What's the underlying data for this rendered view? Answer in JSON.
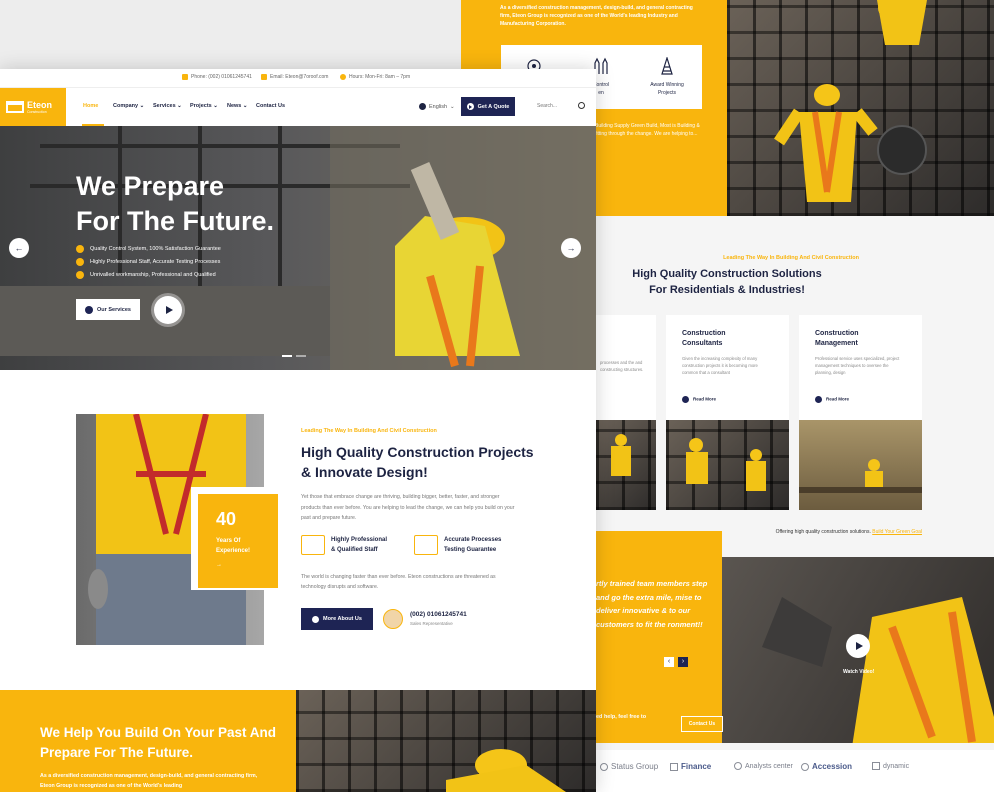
{
  "back_panel": {
    "intro_text": "As a diversified construction management, design-build, and general contracting firm, Eteon Group is recognized as one of the World's leading Industry and Manufacturing Corporation.",
    "feature_cards": [
      {
        "label": "",
        "icon": "gears-icon"
      },
      {
        "label": "Control\nen",
        "icon": "gloves-icon"
      },
      {
        "label": "Award Winning\nProjects",
        "icon": "tower-icon"
      }
    ],
    "yellow_small_text": "Building Supply Green Build, Most is Building & fitting through the change. We are helping to...",
    "eyebrow": "Leading The Way In Building And Civil Construction",
    "title_line1": "High Quality Construction Solutions",
    "title_line2": "For Residentials & Industries!",
    "services": [
      {
        "title": "",
        "desc": "processes and the and constructing structures.",
        "link": ""
      },
      {
        "title": "Construction\nConsultants",
        "desc": "Given the increasing complexity of many construction projects it is becoming more common that a consultant",
        "link": "Read More"
      },
      {
        "title": "Construction\nManagement",
        "desc": "Professional service uses specialized, project management techniques to oversee the planning, design",
        "link": "Read More"
      }
    ],
    "offer_text": "Offering high quality construction solutions.",
    "offer_link": "Build Your Green Goal",
    "quote_text": "rtly trained team members step and go the extra mile, mise to deliver innovative & to our customers to fit the ronment!!",
    "watch_label": "Watch Video!",
    "cta_text": "ed help, feel free to",
    "contact_label": "Contact Us",
    "arrows": [
      "‹",
      "›"
    ],
    "partners": [
      "Status Group",
      "Finance",
      "Analysts center",
      "Accession",
      "dynamic"
    ]
  },
  "topbar": {
    "phone": "Phone: (002) 01061245741",
    "email": "Email: Eteon@7oroof.com",
    "hours": "Hours: Mon-Fri: 8am – 7pm"
  },
  "brand": {
    "name": "Eteon",
    "tagline": "Construction"
  },
  "nav": {
    "items": [
      "Home",
      "Company",
      "Services",
      "Projects",
      "News",
      "Contact Us"
    ],
    "language": "English",
    "quote_button": "Get A Quote",
    "search_placeholder": "Search..."
  },
  "hero": {
    "title_line1": "We Prepare",
    "title_line2": "For The Future.",
    "checks": [
      "Quality Control System, 100% Satisfaction Guarantee",
      "Highly Professional Staff, Accurate Testing Processes",
      "Unrivalled workmanship, Professional and Qualified"
    ],
    "services_button": "Our Services",
    "prev": "←",
    "next": "→"
  },
  "about": {
    "years": "40",
    "years_label": "Years Of\nExperience!",
    "years_arrow": "→",
    "eyebrow": "Leading The Way In Building And Civil Construction",
    "title": "High Quality Construction Projects & Innovate Design!",
    "paragraph": "Yet those that embrace change are thriving, building bigger, better, faster, and stronger products than ever before. You are helping to lead the change, we can help you build on your past and prepare future.",
    "feature1": "Highly Professional\n& Qualified Staff",
    "feature2": "Accurate Processes\nTesting Guarantee",
    "paragraph2": "The world is changing faster than ever before. Eteon constructions are threatened as technology disrupts and software.",
    "more_button": "More About Us",
    "rep_phone": "(002) 01061245741",
    "rep_role": "Sales Representative"
  },
  "bottom": {
    "title": "We Help You Build On Your Past And Prepare For The Future.",
    "paragraph": "As a diversified construction management, design-build, and general contracting firm, Eteon Group is recognized as one of the World's leading"
  },
  "colors": {
    "accent": "#f9b50d",
    "navy": "#1e2454"
  }
}
